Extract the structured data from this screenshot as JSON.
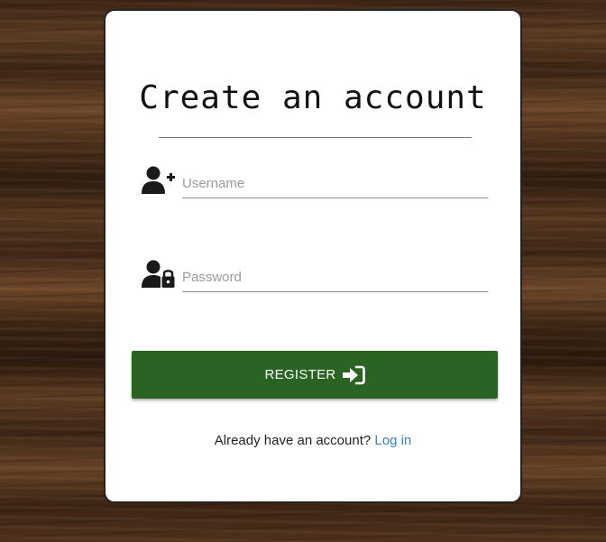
{
  "form": {
    "title": "Create an account",
    "username": {
      "placeholder": "Username",
      "value": "",
      "icon": "user-plus-icon"
    },
    "password": {
      "placeholder": "Password",
      "value": "",
      "icon": "user-lock-icon"
    },
    "register_button": {
      "label": "REGISTER",
      "icon": "sign-in-icon",
      "color": "#2a6423"
    },
    "footer": {
      "prompt": "Already have an account?",
      "link_label": "Log in",
      "link_color": "#3b82c4"
    }
  }
}
